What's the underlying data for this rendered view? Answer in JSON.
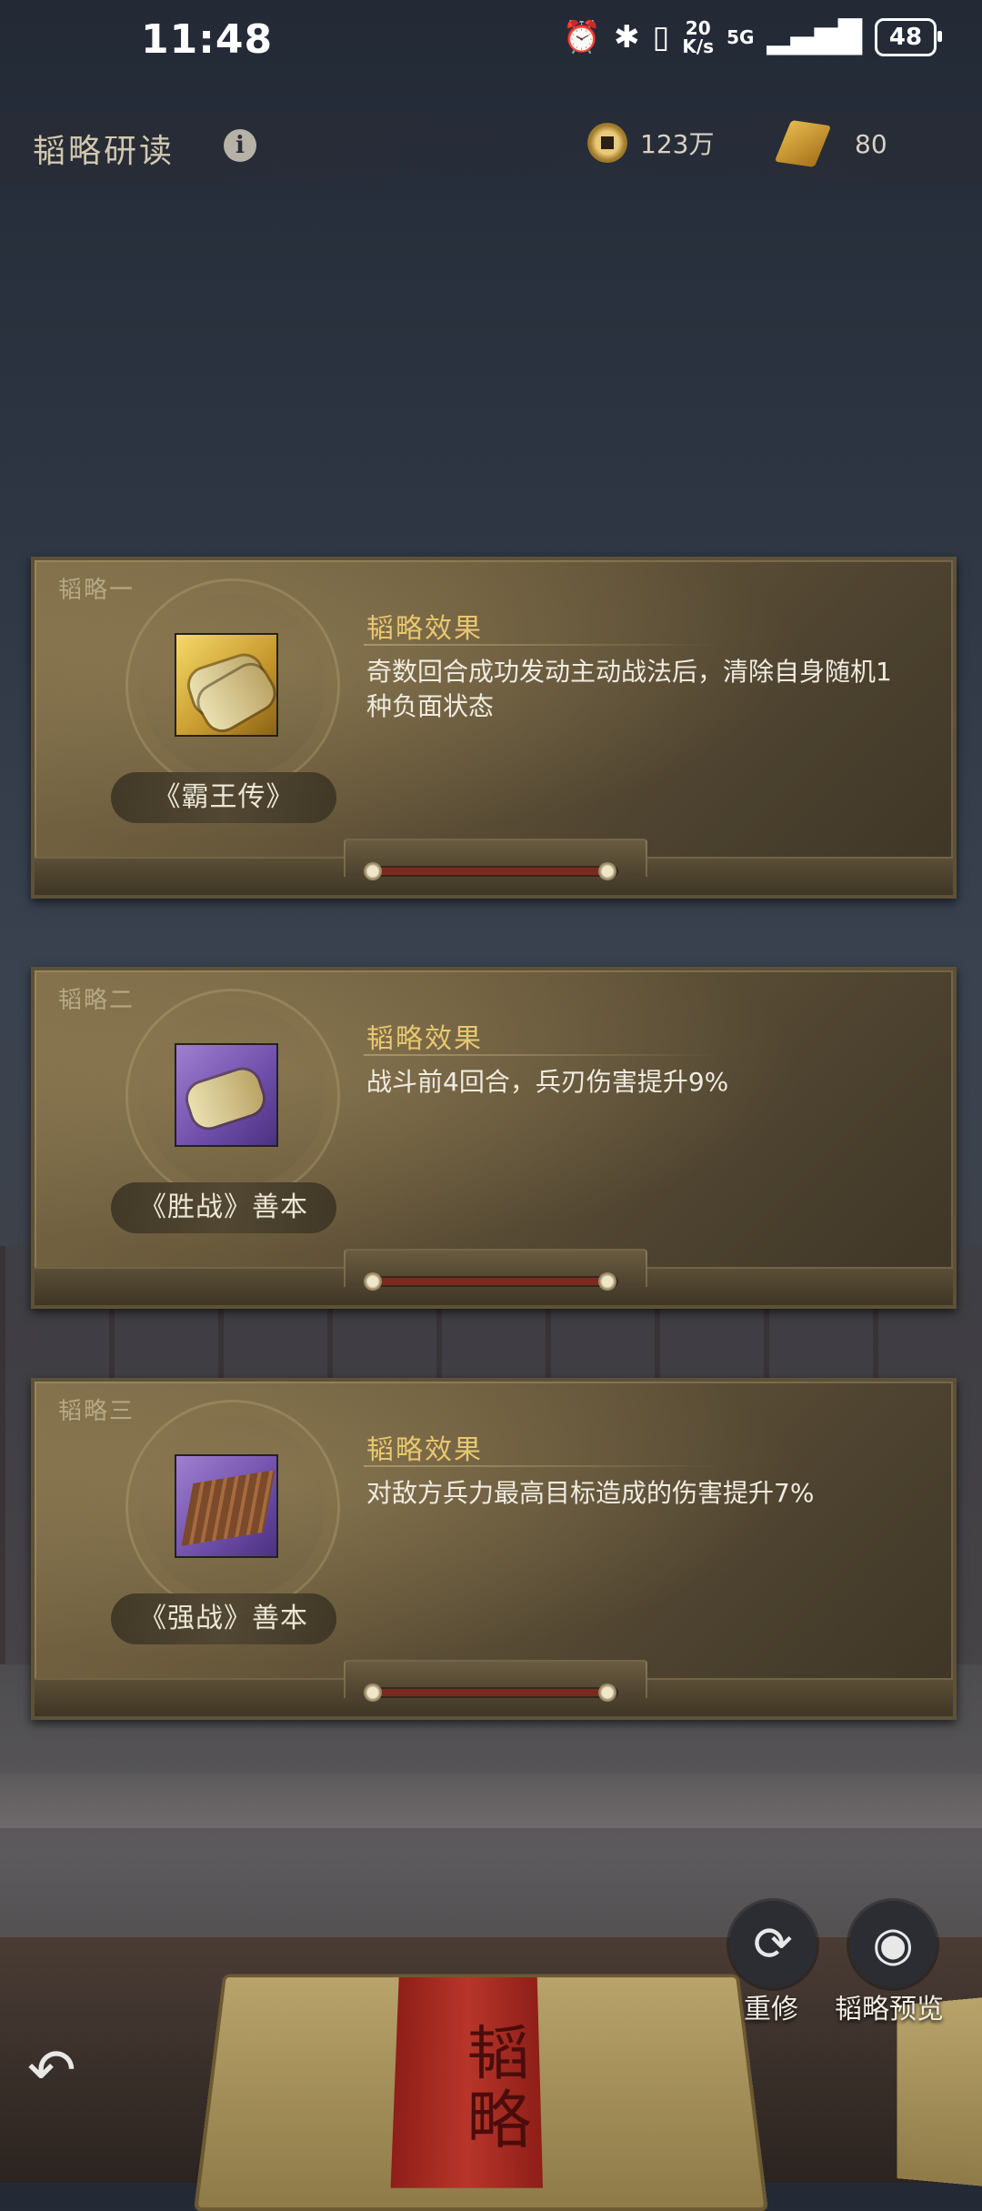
{
  "status_bar": {
    "time": "11:48",
    "net_speed_top": "20",
    "net_speed_bottom": "K/s",
    "network": "5G",
    "battery": "48"
  },
  "header": {
    "title": "韬略研读",
    "coins": "123万",
    "scrolls": "80"
  },
  "cards": [
    {
      "label": "韬略一",
      "book_name": "《霸王传》",
      "effect_title": "韬略效果",
      "effect_text": "奇数回合成功发动主动战法后，清除自身随机1种负面状态",
      "rarity": "gold"
    },
    {
      "label": "韬略二",
      "book_name": "《胜战》善本",
      "effect_title": "韬略效果",
      "effect_text": "战斗前4回合，兵刃伤害提升9%",
      "rarity": "purple"
    },
    {
      "label": "韬略三",
      "book_name": "《强战》善本",
      "effect_title": "韬略效果",
      "effect_text": "对敌方兵力最高目标造成的伤害提升7%",
      "rarity": "purple"
    }
  ],
  "actions": {
    "refresh_label": "重修",
    "preview_label": "韬略预览"
  },
  "book": {
    "title": "韬略"
  },
  "colors": {
    "accent_gold": "#e8c771",
    "card_bg": "#6a5a3c",
    "progress_red": "#7c2a1f"
  }
}
